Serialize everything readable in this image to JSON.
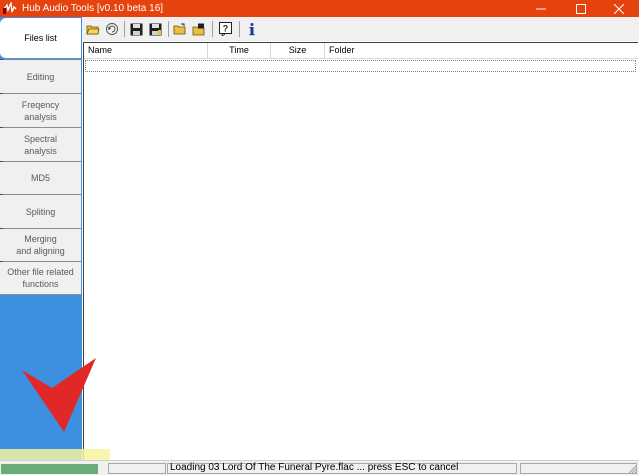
{
  "window": {
    "title": "Hub Audio Tools [v0.10 beta 16]",
    "accent_color": "#e5420d"
  },
  "toolbar": {
    "buttons": [
      {
        "icon": "open-folder-icon"
      },
      {
        "icon": "refresh-icon"
      },
      {
        "icon": "save-icon"
      },
      {
        "icon": "save-all-icon"
      },
      {
        "icon": "open-file-icon"
      },
      {
        "icon": "open-files-icon"
      },
      {
        "icon": "help-icon"
      },
      {
        "icon": "info-icon"
      }
    ]
  },
  "sidebar": {
    "color": "#3d8fe0",
    "tabs": [
      {
        "label": "Files list",
        "active": true
      },
      {
        "label": "Editing",
        "active": false
      },
      {
        "label": "Freqency\nanalysis",
        "active": false
      },
      {
        "label": "Spectral\nanalysis",
        "active": false
      },
      {
        "label": "MD5",
        "active": false
      },
      {
        "label": "Spliting",
        "active": false
      },
      {
        "label": "Merging\nand aligning",
        "active": false
      },
      {
        "label": "Other file related\nfunctions",
        "active": false
      }
    ]
  },
  "file_list": {
    "columns": [
      "Name",
      "Time",
      "Size",
      "Folder"
    ],
    "rows": []
  },
  "status": {
    "text": "Loading 03 Lord Of The Funeral Pyre.flac ... press ESC to cancel",
    "progress_color": "#6aab7a"
  }
}
